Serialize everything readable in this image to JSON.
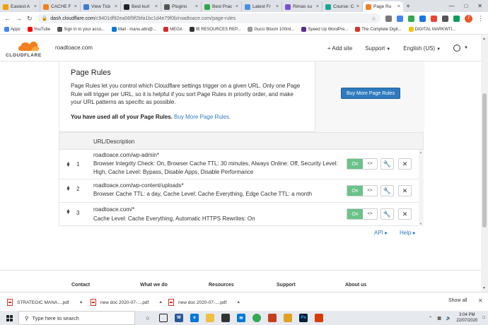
{
  "browser": {
    "tabs": [
      {
        "label": "Easiest A",
        "color": "#f29f05",
        "active": false
      },
      {
        "label": "CACHE F",
        "color": "#f38020",
        "active": false
      },
      {
        "label": "View Tick",
        "color": "#3a7bd5",
        "active": false
      },
      {
        "label": "Best kurl",
        "color": "#222222",
        "active": false
      },
      {
        "label": "Plugins",
        "color": "#555555",
        "active": false
      },
      {
        "label": "Best Prac",
        "color": "#2ea44f",
        "active": false
      },
      {
        "label": "Latest Fr",
        "color": "#4a90e2",
        "active": false
      },
      {
        "label": "Rimas su",
        "color": "#7b4fd1",
        "active": false
      },
      {
        "label": "Course: C",
        "color": "#1aa59a",
        "active": false
      },
      {
        "label": "Page Ru",
        "color": "#f38020",
        "active": true
      }
    ],
    "url_host": "dash.cloudflare.com",
    "url_path": "/c9401df92ea06f9f2bfa1bc1d4e79f0b/roadtoace.com/page-rules",
    "profile_initial": "7",
    "bookmarks": [
      {
        "label": "Apps",
        "color": "#4285f4"
      },
      {
        "label": "YouTube",
        "color": "#ff0000"
      },
      {
        "label": "Sign in to your acco...",
        "color": "#555555"
      },
      {
        "label": "Mail - manu.attri@...",
        "color": "#0078d4"
      },
      {
        "label": "MEGA",
        "color": "#d9272e"
      },
      {
        "label": "IB RESOURCES REP...",
        "color": "#333333"
      },
      {
        "label": "Gucci Bloom 100ml...",
        "color": "#999999"
      },
      {
        "label": "Speed Up WordPre...",
        "color": "#5b2d8e"
      },
      {
        "label": "The Complete Digit...",
        "color": "#d93025"
      },
      {
        "label": "DIGITAL MARKWTI...",
        "color": "#f4c20d"
      }
    ]
  },
  "header": {
    "logo_text": "CLOUDFLARE",
    "domain": "roadtoace.com",
    "add_site": "+ Add site",
    "support": "Support",
    "language": "English (US)"
  },
  "intro": {
    "title": "Page Rules",
    "description": "Page Rules let you control which Cloudflare settings trigger on a given URL. Only one Page Rule will trigger per URL, so it is helpful if you sort Page Rules in priority order, and make your URL patterns as specific as possible.",
    "used_text": "You have used all of your Page Rules.",
    "buy_link": "Buy More Page Rules.",
    "buy_button": "Buy More Page Rules"
  },
  "rules": {
    "column_header": "URL/Description",
    "rows": [
      {
        "number": "1",
        "url": "roadtoace.com/wp-admin*",
        "description": "Browser Integrity Check: On, Browser Cache TTL: 30 minutes, Always Online: Off, Security Level: High, Cache Level: Bypass, Disable Apps, Disable Performance",
        "toggle": "On"
      },
      {
        "number": "2",
        "url": "roadtoace.com/wp-content/uploads*",
        "description": "Browser Cache TTL: a day, Cache Level: Cache Everything, Edge Cache TTL: a month",
        "toggle": "On"
      },
      {
        "number": "3",
        "url": "roadtoace.com/*",
        "description": "Cache Level: Cache Everything, Automatic HTTPS Rewrites: On",
        "toggle": "On"
      }
    ]
  },
  "links": {
    "api": "API ▸",
    "help": "Help ▸"
  },
  "footer": {
    "contact": "Contact",
    "what_we_do": "What we do",
    "resources": "Resources",
    "support": "Support",
    "about_us": "About us"
  },
  "downloads": {
    "items": [
      "STRATEGIC MANA....pdf",
      "new doc 2020-07-....pdf",
      "new doc 2020-07-....pdf"
    ],
    "show_all": "Show all"
  },
  "taskbar": {
    "search_placeholder": "Type here to search",
    "time": "3:04 PM",
    "date": "22/07/2020"
  }
}
